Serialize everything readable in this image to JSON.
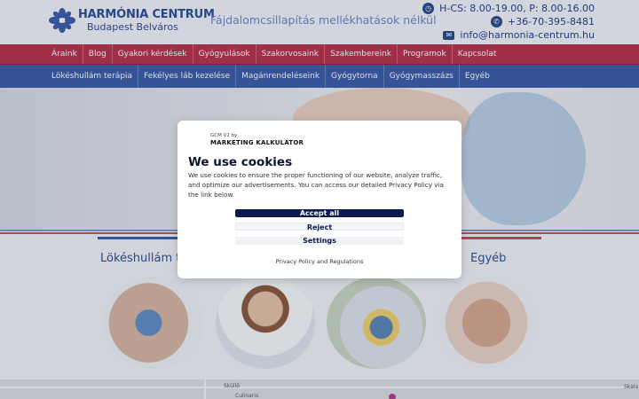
{
  "header": {
    "brand": "HARMÓNIA CENTRUM",
    "brand_sub": "Budapest Belváros",
    "tagline": "Fájdalomcsillapítás mellékhatások nélkül",
    "hours": "H-CS: 8.00-19.00, P: 8.00-16.00",
    "phone": "+36-70-395-8481",
    "email": "info@harmonia-centrum.hu"
  },
  "nav_primary": [
    "Áraink",
    "Blog",
    "Gyakori kérdések",
    "Gyógyulások",
    "Szakorvosaink",
    "Szakembereink",
    "Programok",
    "Kapcsolat"
  ],
  "nav_secondary": [
    "Lökéshullám terápia",
    "Fekélyes láb kezelése",
    "Magánrendeléseink",
    "Gyógytorna",
    "Gyógymasszázs",
    "Egyéb"
  ],
  "cards": {
    "first_title": "Lökéshullám te",
    "last_title": "Egyéb"
  },
  "map": {
    "labels": [
      "Sküllő",
      "Culinaris",
      "Skala"
    ]
  },
  "cookie_modal": {
    "vendor_small": "GCM V2 by",
    "vendor_brand": "MARKETING KALKULÁTOR",
    "title": "We use cookies",
    "text": "We use cookies to ensure the proper functioning of our website, analyze traffic, and optimize our advertisements. You can access our detailed Privacy Policy via the link below.",
    "accept_label": "Accept all",
    "reject_label": "Reject",
    "settings_label": "Settings",
    "privacy_link": "Privacy Policy and Regulations"
  },
  "colors": {
    "brand_blue": "#2a4d93",
    "nav_red": "#b8324b",
    "nav_blue": "#3a5ca6",
    "accept_button": "#0c1b4d"
  }
}
